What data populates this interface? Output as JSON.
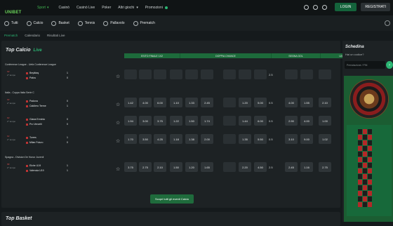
{
  "header": {
    "logo": "UNIBET",
    "sport_menu": "Sport",
    "nav": [
      "Casinò",
      "Casinò Live",
      "Poker",
      "Altri giochi",
      "Promozioni"
    ],
    "login": "LOGIN",
    "register": "REGISTRATI"
  },
  "tabs": [
    "Tutti",
    "Calcio",
    "Basket",
    "Tennis",
    "Pallavolo",
    "Prematch"
  ],
  "subtabs": [
    "Prematch",
    "Calendario",
    "Risultati Live"
  ],
  "section": {
    "title": "Top Calcio",
    "live": "Live"
  },
  "markets": [
    "ESITO FINALE 1X2",
    "DOPPIA CHANCE",
    "SEGNA GOL",
    "U/O",
    "G/NG"
  ],
  "market_sub": [
    "1",
    "X",
    "2",
    "1X",
    "X2",
    "12",
    "Goal",
    "No Goal",
    "U",
    "O",
    "G",
    "NG"
  ],
  "leagues": [
    {
      "name": "Conference League - Uefa Conference League",
      "matches": [
        {
          "minute": "63'",
          "time": "2° tempo",
          "home": "Beşiktaş",
          "away": "Pafos",
          "hs": "1",
          "as": "0",
          "odds": [
            "",
            "",
            "",
            "",
            "",
            "",
            "",
            "",
            "",
            "",
            "",
            ""
          ],
          "line": "2.5"
        }
      ]
    },
    {
      "name": "Italia - Coppa Italia Serie C",
      "matches": [
        {
          "minute": "64'",
          "time": "2° tempo",
          "home": "Padova",
          "away": "Caldiero Terme",
          "hs": "0",
          "as": "1",
          "odds": [
            "1.42",
            "4.00",
            "6.00",
            "1.10",
            "1.33",
            "2.45",
            "",
            "1.20",
            "5.00",
            "4.00",
            "1.55",
            "2.10"
          ],
          "line": "0.5"
        },
        {
          "minute": "60'",
          "time": "2° tempo",
          "home": "Giana Erminio",
          "away": "Pro Vercelli",
          "hs": "0",
          "as": "0",
          "odds": [
            "1.94",
            "3.00",
            "3.75",
            "1.22",
            "1.50",
            "1.74",
            "",
            "1.44",
            "6.00",
            "2.90",
            "4.00",
            "1.00"
          ],
          "line": "0.5"
        },
        {
          "minute": "61'",
          "time": "2° tempo",
          "home": "Torres",
          "away": "Milan Futuro",
          "hs": "1",
          "as": "0",
          "odds": [
            "1.70",
            "3.50",
            "4.25",
            "1.18",
            "1.38",
            "2.00",
            "",
            "1.35",
            "5.50",
            "3.10",
            "9.00",
            "1.02"
          ],
          "line": "0.5"
        }
      ]
    },
    {
      "name": "Spagna - Division De Honor Juvenil",
      "matches": [
        {
          "minute": "58'",
          "time": "2° tempo",
          "home": "Elche U19",
          "away": "Valencia U19",
          "hs": "1",
          "as": "1",
          "odds": [
            "3.75",
            "2.75",
            "2.10",
            "1.50",
            "1.20",
            "1.65",
            "",
            "2.20",
            "4.50",
            "2.45",
            "1.16",
            "2.75"
          ],
          "line": "2.5"
        }
      ]
    }
  ],
  "show_all": "Scopri tutti gli eventi Calcio",
  "next_section": "Top Basket",
  "schedina": {
    "title": "Schedina",
    "code_q": "Hai un codice?",
    "pin_placeholder": "Prenotazione / PIN"
  },
  "colors": {
    "accent": "#2bb673",
    "market": "#1d6b3b"
  }
}
